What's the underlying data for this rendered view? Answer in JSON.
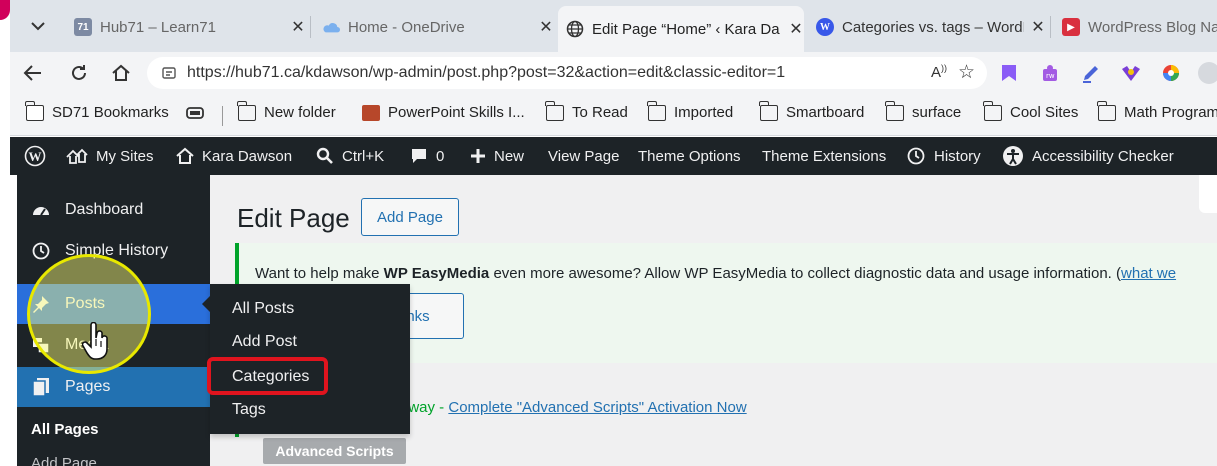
{
  "tabs": [
    {
      "title": "Hub71 – Learn71",
      "favicon": "hub71-icon",
      "color": "#6a7c9e"
    },
    {
      "title": "Home - OneDrive",
      "favicon": "onedrive-icon",
      "color": "#4a8fe7"
    },
    {
      "title": "Edit Page “Home” ‹ Kara Da",
      "favicon": "globe-icon",
      "color": "#333333",
      "active": true
    },
    {
      "title": "Categories vs. tags – WordP",
      "favicon": "wordpress-icon",
      "color": "#3858e9"
    },
    {
      "title": "WordPress Blog Na",
      "favicon": "youtube-icon",
      "color": "#d9303f"
    }
  ],
  "address": {
    "url": "https://hub71.ca/kdawson/wp-admin/post.php?post=32&action=edit&classic-editor=1"
  },
  "bookmarks": [
    {
      "label": "SD71 Bookmarks",
      "icon": "bookmark-folder-icon"
    },
    {
      "label": "",
      "icon": "device-icon"
    },
    {
      "label": "New folder",
      "icon": "folder-icon"
    },
    {
      "label": "PowerPoint Skills I...",
      "icon": "powerpoint-icon"
    },
    {
      "label": "To Read",
      "icon": "folder-icon"
    },
    {
      "label": "Imported",
      "icon": "folder-icon"
    },
    {
      "label": "Smartboard",
      "icon": "folder-icon"
    },
    {
      "label": "surface",
      "icon": "folder-icon"
    },
    {
      "label": "Cool Sites",
      "icon": "folder-icon"
    },
    {
      "label": "Math Program",
      "icon": "folder-icon"
    }
  ],
  "adminbar": {
    "my_sites": "My Sites",
    "site_name": "Kara Dawson",
    "search": "Ctrl+K",
    "comments_count": "0",
    "new": "New",
    "view_page": "View Page",
    "theme_options": "Theme Options",
    "theme_extensions": "Theme Extensions",
    "history": "History",
    "accessibility_checker": "Accessibility Checker"
  },
  "sidebar": {
    "items": [
      {
        "label": "Dashboard",
        "icon": "dashboard-icon"
      },
      {
        "label": "Simple History",
        "icon": "history-icon"
      },
      {
        "label": "Posts",
        "icon": "pin-icon"
      },
      {
        "label": "Media",
        "icon": "media-icon"
      },
      {
        "label": "Pages",
        "icon": "pages-icon"
      }
    ],
    "sub_items": [
      "All Pages",
      "Add Page"
    ]
  },
  "flyout": {
    "items": [
      "All Posts",
      "Add Post",
      "Categories",
      "Tags"
    ]
  },
  "content": {
    "title": "Edit Page",
    "add_page": "Add Page",
    "notice_prefix": "Want to help make ",
    "notice_strong": "WP EasyMedia",
    "notice_middle": " even more awesome? Allow WP EasyMedia to collect diagnostic data and usage information. (",
    "notice_link": "what we",
    "notice_button": "anks",
    "notice2_prefix": "away - ",
    "notice2_link": "Complete \"Advanced Scripts\" Activation Now",
    "advanced_scripts": "Advanced Scripts"
  },
  "colors": {
    "admin_dark": "#1d2327",
    "wp_blue": "#2271b1",
    "highlight_red": "#e0141e",
    "notice_green": "#00a32a"
  }
}
